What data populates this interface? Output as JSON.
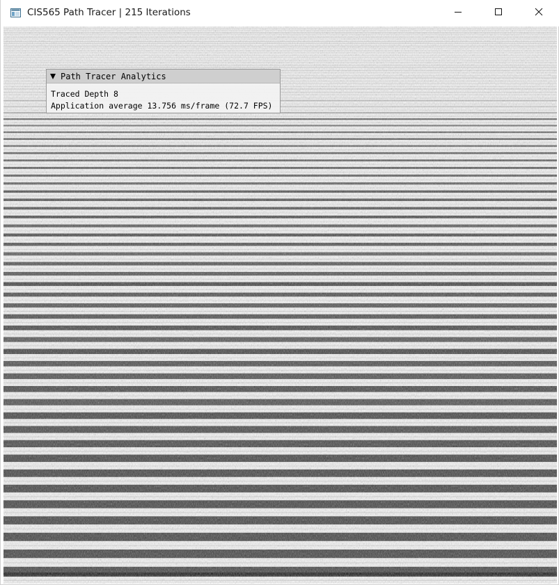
{
  "window": {
    "title": "CIS565 Path Tracer | 215 Iterations",
    "icons": {
      "app": "app-window-icon",
      "minimize": "minimize-icon",
      "maximize": "maximize-icon",
      "close": "close-icon"
    }
  },
  "analytics": {
    "header": "Path Tracer Analytics",
    "collapse_icon": "triangle-down-icon",
    "traced_depth_label": "Traced Depth 8",
    "fps_label": "Application average 13.756 ms/frame (72.7 FPS)"
  },
  "render": {
    "description_colors": {
      "light": "#f4f4f4",
      "dark": "#2a2a2a"
    }
  }
}
